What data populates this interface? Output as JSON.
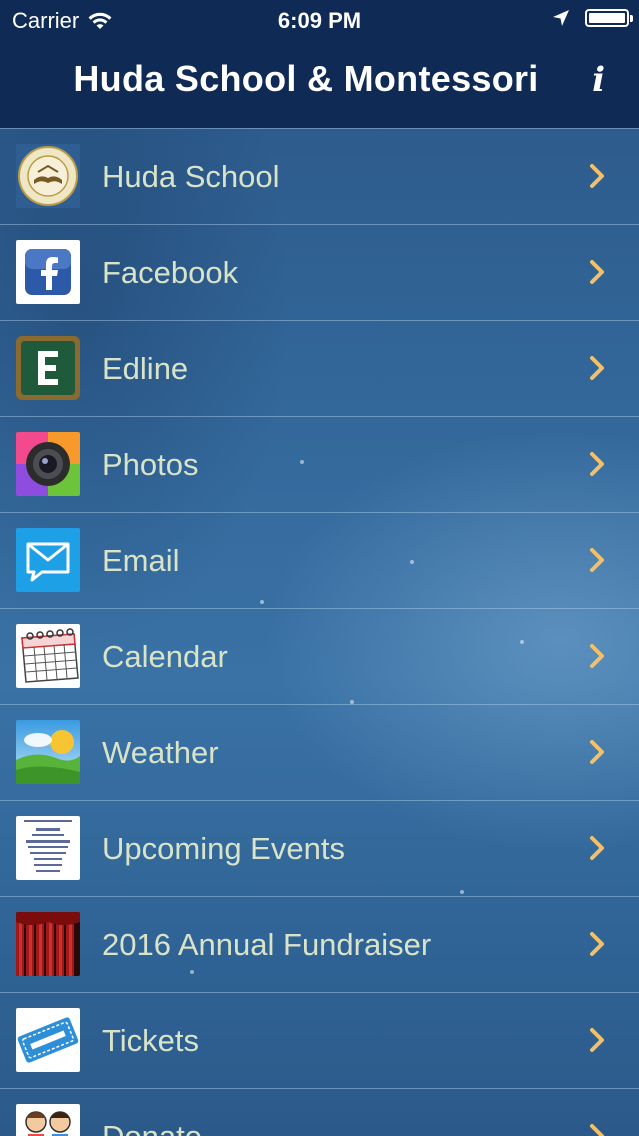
{
  "status_bar": {
    "carrier": "Carrier",
    "time": "6:09 PM"
  },
  "nav_bar": {
    "title": "Huda School & Montessori",
    "info_label": "i"
  },
  "menu": {
    "items": [
      {
        "label": "Huda School",
        "icon": "school-seal-icon"
      },
      {
        "label": "Facebook",
        "icon": "facebook-icon"
      },
      {
        "label": "Edline",
        "icon": "edline-icon"
      },
      {
        "label": "Photos",
        "icon": "camera-icon"
      },
      {
        "label": "Email",
        "icon": "email-icon"
      },
      {
        "label": "Calendar",
        "icon": "calendar-icon"
      },
      {
        "label": "Weather",
        "icon": "weather-icon"
      },
      {
        "label": "Upcoming Events",
        "icon": "events-flyer-icon"
      },
      {
        "label": "2016 Annual Fundraiser",
        "icon": "theater-curtain-icon"
      },
      {
        "label": "Tickets",
        "icon": "ticket-icon"
      },
      {
        "label": "Donate",
        "icon": "donate-kids-icon"
      }
    ]
  },
  "colors": {
    "nav_bar_background": "#0f2a55",
    "menu_label": "#d8e3c8",
    "chevron": "#f2c069",
    "background": "#33679a"
  }
}
